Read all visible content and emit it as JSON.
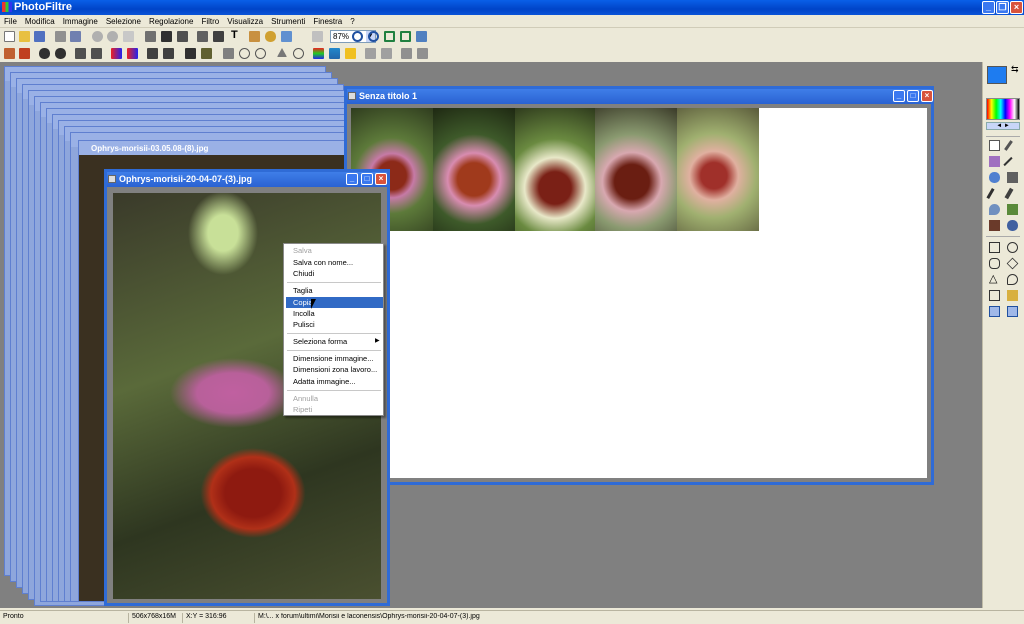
{
  "app": {
    "title": "PhotoFiltre"
  },
  "menu": [
    "File",
    "Modifica",
    "Immagine",
    "Selezione",
    "Regolazione",
    "Filtro",
    "Visualizza",
    "Strumenti",
    "Finestra",
    "?"
  ],
  "toolbar": {
    "zoom_value": "87%"
  },
  "windows": {
    "background_title": "Ophrys-morisii-03.05.08-(8).jpg",
    "active_title": "Ophrys-morisii-20-04-07-(3).jpg",
    "canvas_title": "Senza titolo 1"
  },
  "context_menu": {
    "items": [
      {
        "label": "Salva",
        "disabled": true
      },
      {
        "label": "Salva con nome...",
        "disabled": false
      },
      {
        "label": "Chiudi",
        "disabled": false
      },
      {
        "label": "Taglia",
        "disabled": false
      },
      {
        "label": "Copia",
        "disabled": false,
        "selected": true
      },
      {
        "label": "Incolla",
        "disabled": false
      },
      {
        "label": "Pulisci",
        "disabled": false
      },
      {
        "label": "Seleziona forma",
        "disabled": false,
        "submenu": true
      },
      {
        "label": "Dimensione immagine...",
        "disabled": false
      },
      {
        "label": "Dimensioni zona lavoro...",
        "disabled": false
      },
      {
        "label": "Adatta immagine...",
        "disabled": false
      },
      {
        "label": "Annulla",
        "disabled": true
      },
      {
        "label": "Ripeti",
        "disabled": true
      }
    ]
  },
  "status": {
    "state": "Pronto",
    "size": "506x768x16M",
    "coords": "X:Y = 316:96",
    "path": "M:\\... x forum\\ultimi\\Morisii e laconensis\\Ophrys-morisii-20-04-07-(3).jpg"
  },
  "colors": {
    "foreground": "#1e7cf0",
    "background": "#ffffff",
    "titlebar": "#0a54d8",
    "workspace": "#808080"
  }
}
